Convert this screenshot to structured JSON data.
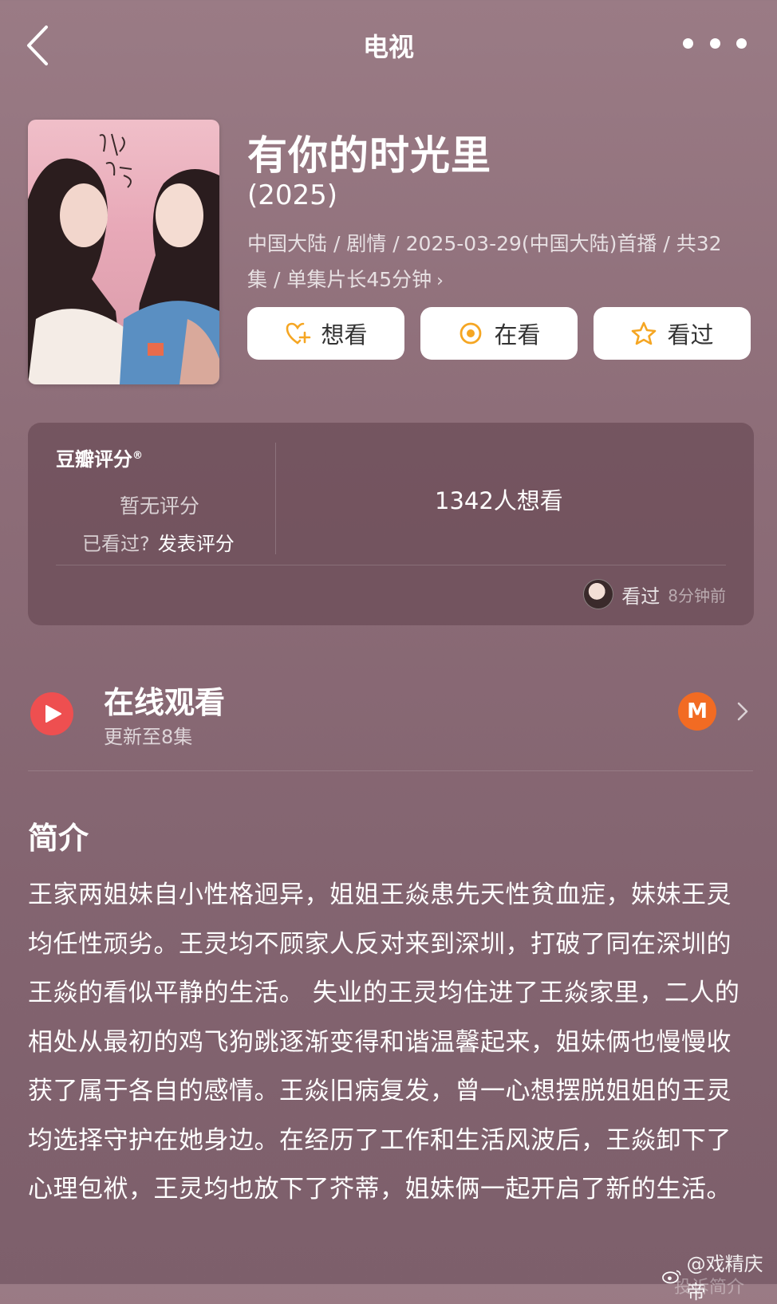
{
  "nav": {
    "title": "电视"
  },
  "show": {
    "title": "有你的时光里",
    "year": "(2025)",
    "meta_line1": "中国大陆 / 剧情 / 2025-03-29(中国大陆)首播 / 共32",
    "meta_line2": "集 / 单集片长45分钟",
    "meta_chevron": "›"
  },
  "actions": {
    "want": "想看",
    "watching": "在看",
    "watched": "看过",
    "accent_color": "#f5a623"
  },
  "rating": {
    "title": "豆瓣评分",
    "trademark": "®",
    "no_rating": "暂无评分",
    "seen_question": "已看过?",
    "post_rating": "发表评分",
    "want_count": "1342人想看",
    "recent_action": "看过",
    "recent_time": "8分钟前"
  },
  "online": {
    "title": "在线观看",
    "subtitle": "更新至8集",
    "play_color": "#ee4f50",
    "provider_icon": "mgtv-icon"
  },
  "synopsis": {
    "heading": "简介",
    "text": "王家两姐妹自小性格迥异，姐姐王焱患先天性贫血症，妹妹王灵均任性顽劣。王灵均不顾家人反对来到深圳，打破了同在深圳的王焱的看似平静的生活。 失业的王灵均住进了王焱家里，二人的相处从最初的鸡飞狗跳逐渐变得和谐温馨起来，姐妹俩也慢慢收获了属于各自的感情。王焱旧病复发，曾一心想摆脱姐姐的王灵均选择守护在她身边。在经历了工作和生活风波后，王焱卸下了心理包袱，王灵均也放下了芥蒂，姐妹俩一起开启了新的生活。"
  },
  "watermark": {
    "text": "@戏精庆帝",
    "report": "投诉简介"
  }
}
